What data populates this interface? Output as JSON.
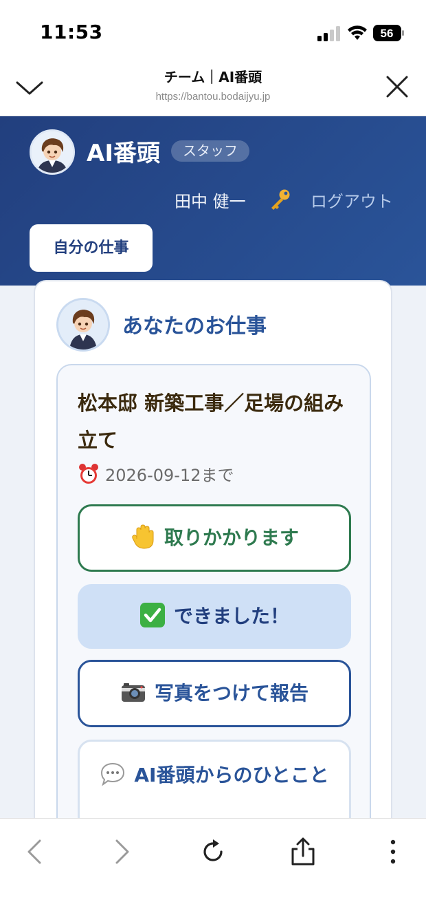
{
  "status_bar": {
    "time": "11:53",
    "battery": "56",
    "icons": [
      "cellular-signal-icon",
      "wifi-icon",
      "battery-icon"
    ]
  },
  "browser": {
    "title": "チーム｜AI番頭",
    "url": "https://bantou.bodaijyu.jp",
    "icons": [
      "chevron-down-icon",
      "close-icon"
    ]
  },
  "app_header": {
    "app_name": "AI番頭",
    "role_badge": "スタッフ",
    "user_name": "田中 健一",
    "logout_label": "ログアウト",
    "tab_label": "自分の仕事",
    "colors": {
      "primary": "#223f7e",
      "primary_light": "#2a5499"
    }
  },
  "card": {
    "title": "あなたのお仕事",
    "task": {
      "title": "松本邸 新築工事／足場の組み立て",
      "deadline": "2026-09-12まで",
      "deadline_icon": "alarm-clock-icon"
    },
    "buttons": {
      "start": {
        "label": "取りかかります",
        "icon": "raised-hand-icon",
        "color": "#2e7a4f"
      },
      "done": {
        "label": "できました！",
        "icon": "check-mark-icon",
        "color": "#223f7e"
      },
      "photo": {
        "label": "写真をつけて報告",
        "icon": "camera-icon",
        "color": "#2a5499"
      },
      "ai": {
        "label": "AI番頭からのひとこと",
        "icon": "speech-bubble-icon"
      }
    }
  },
  "bottom_bar": {
    "icons": [
      "back-icon",
      "forward-icon",
      "reload-icon",
      "share-icon",
      "more-icon"
    ]
  }
}
